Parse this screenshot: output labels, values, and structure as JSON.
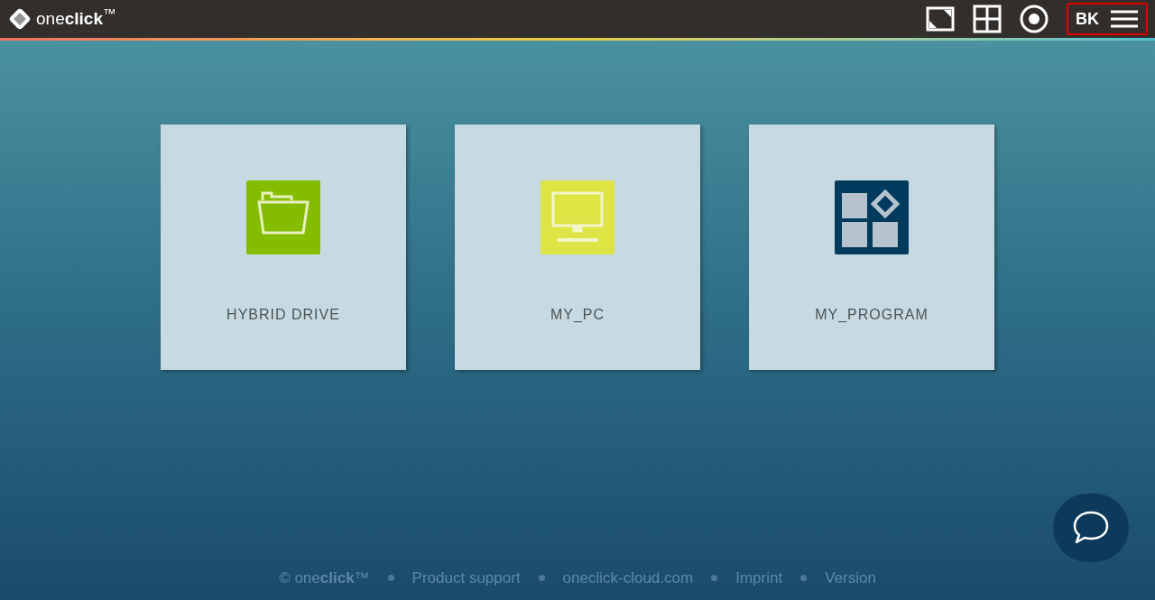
{
  "header": {
    "logo": "one**click**$^{™}$",
    "user_initials": "BK"
  },
  "tiles": [
    {
      "label": "HYBRID DRIVE",
      "kind": "folder",
      "color": "#84bd00"
    },
    {
      "label": "MY_PC",
      "kind": "monitor",
      "color": "#dde444"
    },
    {
      "label": "MY_PROGRAM",
      "kind": "apps",
      "color": "#003a5d"
    }
  ],
  "footer": [
    "© one**click**™",
    "Product support",
    "oneclick-cloud.com",
    "Imprint",
    "Version"
  ]
}
